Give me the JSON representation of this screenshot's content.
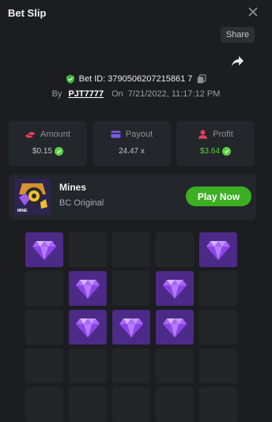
{
  "header": {
    "title": "Bet Slip",
    "share_tooltip": "Share"
  },
  "bet": {
    "id": "Bet ID: 3790506207215861 7",
    "by_label": "By",
    "username": "PJT7777",
    "on_label": "On",
    "datetime": "7/21/2022, 11:17:12 PM"
  },
  "stats": [
    {
      "label": "Amount",
      "value": "$0.15"
    },
    {
      "label": "Payout",
      "value": "24.47 x"
    },
    {
      "label": "Profit",
      "value": "$3.64"
    }
  ],
  "game": {
    "name": "Mines",
    "provider": "BC Original",
    "thumb_text": "MINE",
    "play_label": "Play Now"
  },
  "board": {
    "columns": 5,
    "revealed_gems": [
      [
        0,
        0
      ],
      [
        0,
        4
      ],
      [
        1,
        1
      ],
      [
        1,
        3
      ],
      [
        2,
        1
      ],
      [
        2,
        2
      ],
      [
        2,
        3
      ]
    ]
  },
  "colors": {
    "gem_tile": "#4c2a87",
    "play_button": "#3dae23",
    "profit": "#5ad140"
  }
}
